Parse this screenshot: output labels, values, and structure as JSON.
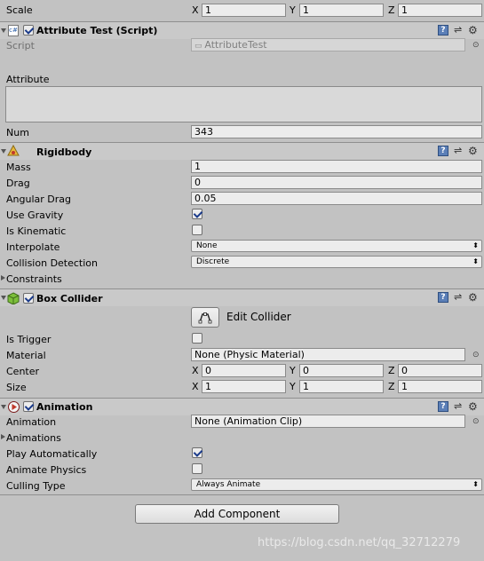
{
  "transform": {
    "scale_label": "Scale",
    "scale": {
      "x": "1",
      "y": "1",
      "z": "1"
    }
  },
  "axis": {
    "x": "X",
    "y": "Y",
    "z": "Z"
  },
  "attribute_test": {
    "title": "Attribute Test (Script)",
    "icon_text": "c#",
    "script_label": "Script",
    "script_value": "AttributeTest",
    "attribute_label": "Attribute",
    "num_label": "Num",
    "num_value": "343"
  },
  "rigidbody": {
    "title": "Rigidbody",
    "mass_label": "Mass",
    "mass": "1",
    "drag_label": "Drag",
    "drag": "0",
    "angular_drag_label": "Angular Drag",
    "angular_drag": "0.05",
    "use_gravity_label": "Use Gravity",
    "use_gravity": true,
    "is_kinematic_label": "Is Kinematic",
    "is_kinematic": false,
    "interpolate_label": "Interpolate",
    "interpolate": "None",
    "collision_label": "Collision Detection",
    "collision": "Discrete",
    "constraints_label": "Constraints"
  },
  "box_collider": {
    "title": "Box Collider",
    "edit_label": "Edit Collider",
    "is_trigger_label": "Is Trigger",
    "is_trigger": false,
    "material_label": "Material",
    "material": "None (Physic Material)",
    "center_label": "Center",
    "center": {
      "x": "0",
      "y": "0",
      "z": "0"
    },
    "size_label": "Size",
    "size": {
      "x": "1",
      "y": "1",
      "z": "1"
    }
  },
  "animation": {
    "title": "Animation",
    "animation_label": "Animation",
    "animation_value": "None (Animation Clip)",
    "animations_label": "Animations",
    "play_auto_label": "Play Automatically",
    "play_auto": true,
    "animate_physics_label": "Animate Physics",
    "animate_physics": false,
    "culling_label": "Culling Type",
    "culling": "Always Animate"
  },
  "add_component_label": "Add Component",
  "watermark": "https://blog.csdn.net/qq_32712279",
  "icons": {
    "help": "help-icon",
    "preset": "preset-icon",
    "gear": "gear-icon",
    "target": "object-picker-icon",
    "fold": "foldout-arrow-icon"
  }
}
